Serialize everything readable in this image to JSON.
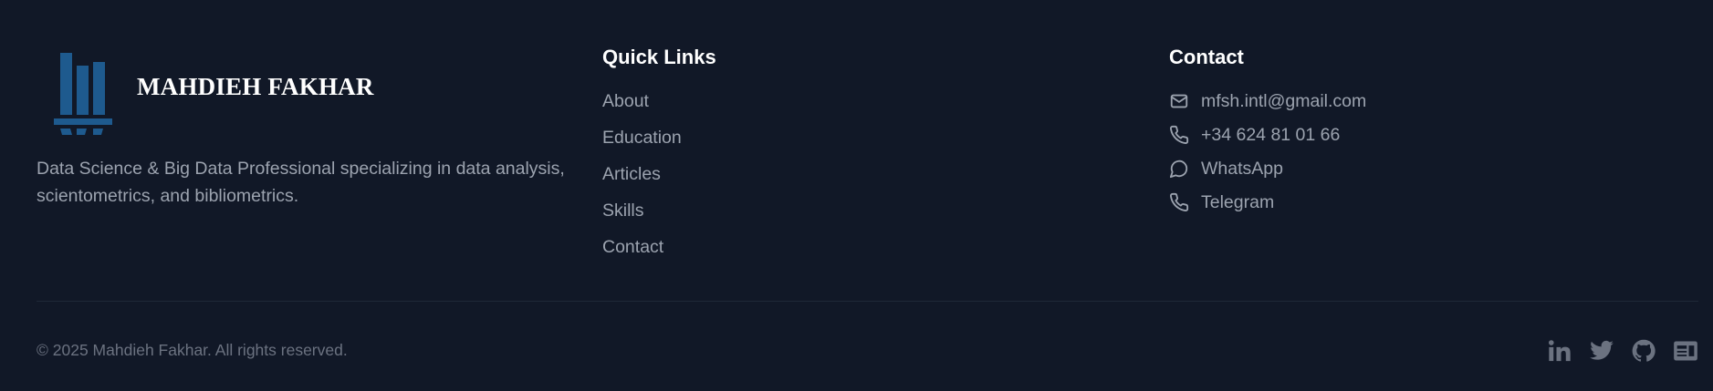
{
  "brand": {
    "name": "MAHDIEH FAKHAR",
    "description": "Data Science & Big Data Professional specializing in data analysis, scientometrics, and bibliometrics.",
    "logo_color": "#1e5a8e"
  },
  "quick_links": {
    "title": "Quick Links",
    "items": [
      "About",
      "Education",
      "Articles",
      "Skills",
      "Contact"
    ]
  },
  "contact": {
    "title": "Contact",
    "items": [
      {
        "icon": "mail-icon",
        "label": "mfsh.intl@gmail.com"
      },
      {
        "icon": "phone-icon",
        "label": "+34 624 81 01 66"
      },
      {
        "icon": "chat-bubble-icon",
        "label": "WhatsApp"
      },
      {
        "icon": "phone-icon",
        "label": "Telegram"
      }
    ]
  },
  "footer_bottom": {
    "copyright": "© 2025 Mahdieh Fakhar. All rights reserved.",
    "socials": [
      "linkedin-icon",
      "twitter-icon",
      "github-icon",
      "id-card-icon"
    ]
  },
  "colors": {
    "background": "#111827",
    "text_muted": "#9ca3af",
    "heading": "#ffffff",
    "icon_gray": "#6b7280"
  }
}
